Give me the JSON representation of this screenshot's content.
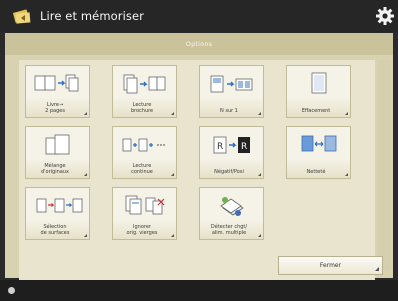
{
  "window": {
    "title": "Lire et mémoriser"
  },
  "options_header": "Options",
  "tiles": [
    {
      "label": "Livre→\n2 pages",
      "icon": "book-to-two-pages-icon"
    },
    {
      "label": "Lecture\nbrochure",
      "icon": "booklet-scan-icon"
    },
    {
      "label": "N sur 1",
      "icon": "n-on-1-icon"
    },
    {
      "label": "Effacement",
      "icon": "erase-frame-icon"
    },
    {
      "label": "Mélange\nd'originaux",
      "icon": "mixed-originals-icon"
    },
    {
      "label": "Lecture\ncontinue",
      "icon": "job-build-icon"
    },
    {
      "label": "Négatif/Posi",
      "icon": "negative-positive-icon"
    },
    {
      "label": "Netteté",
      "icon": "sharpness-icon"
    },
    {
      "label": "Sélection\nde surfaces",
      "icon": "surface-selection-icon"
    },
    {
      "label": "Ignorer\norig. vierges",
      "icon": "skip-blank-originals-icon"
    },
    {
      "label": "Détecter chgt/\nalim. multiple",
      "icon": "detect-multifeed-icon"
    }
  ],
  "close_button": "Fermer",
  "colors": {
    "titlebar": "#262626",
    "panel": "#d8d2b0",
    "tile": "#f5f3e8",
    "accent_blue": "#2f6fc6"
  }
}
